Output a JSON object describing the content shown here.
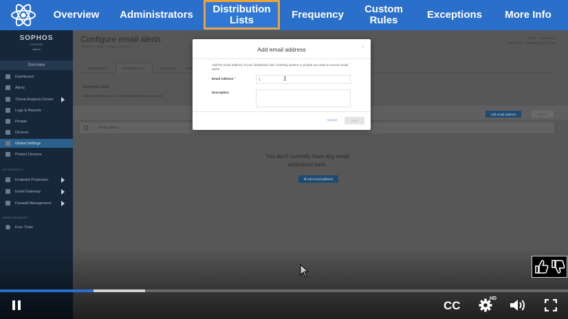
{
  "chapters": {
    "items": [
      {
        "label": "Overview"
      },
      {
        "label": "Administrators"
      },
      {
        "label": "Distribution\nLists",
        "active": true
      },
      {
        "label": "Frequency"
      },
      {
        "label": "Custom\nRules"
      },
      {
        "label": "Exceptions"
      },
      {
        "label": "More Info"
      }
    ],
    "bar_color": "#2a6fc9",
    "active_border_color": "#f0a23a",
    "logo_icon": "atom-icon"
  },
  "sidebar": {
    "brand": "SOPHOS",
    "brand_sub": "CENTRAL",
    "brand_role": "Admin",
    "overview_label": "Overview",
    "items": [
      {
        "label": "Dashboard",
        "icon": "dashboard-icon"
      },
      {
        "label": "Alerts",
        "icon": "alert-icon"
      },
      {
        "label": "Threat Analysis Center",
        "icon": "threat-icon",
        "expandable": true
      },
      {
        "label": "Logs & Reports",
        "icon": "report-icon"
      },
      {
        "label": "People",
        "icon": "people-icon"
      },
      {
        "label": "Devices",
        "icon": "devices-icon"
      },
      {
        "label": "Global Settings",
        "icon": "gear-icon",
        "active": true
      },
      {
        "label": "Protect Devices",
        "icon": "download-icon"
      }
    ],
    "section_products": "MY PRODUCTS",
    "product_items": [
      {
        "label": "Endpoint Protection",
        "icon": "endpoint-icon",
        "expandable": true
      },
      {
        "label": "Email Gateway",
        "icon": "email-icon",
        "expandable": true
      },
      {
        "label": "Firewall Management",
        "icon": "firewall-icon",
        "expandable": true
      }
    ],
    "section_more": "MORE PRODUCTS",
    "more_items": [
      {
        "label": "Free Trials",
        "icon": "plus-circle-icon"
      }
    ]
  },
  "main": {
    "title": "Configure email alerts",
    "breadcrumb": "Settings & Policies  /  Configure email alerts",
    "help_label": "Help ▾",
    "user_name": "Jason Lee ▾",
    "user_org": "Sophos Inc. Standard   Super Admin",
    "tabs": [
      {
        "label": "Administrators"
      },
      {
        "label": "Distribution lists",
        "active": true
      },
      {
        "label": "Frequency"
      },
      {
        "label": "Cust"
      }
    ],
    "section_title": "Distribution lists",
    "section_desc": "Add the distribution lists or email addresses that you want t",
    "add_button": "Add email address",
    "delete_button": "Delete",
    "table_header": "Email address",
    "empty_message": "You don't currently have any email addresses here.",
    "empty_add_button": "✚ Add email address"
  },
  "modal": {
    "title": "Add email address",
    "close": "×",
    "description": "Add the email address of your distribution lists, ticketing system or people you want to receive email alerts.",
    "email_label": "Email Address",
    "required_mark": "*",
    "email_value": "|",
    "description_label": "Description",
    "description_value": "",
    "cancel_label": "Cancel",
    "save_label": "Save"
  },
  "player": {
    "progress": 0.165,
    "buffered": 0.255,
    "cc_label": "CC",
    "hd_label": "HD",
    "progress_color": "#2a6fc9",
    "icons": [
      "pause-icon",
      "settings-icon",
      "volume-icon",
      "fullscreen-icon",
      "thumbs-up-icon",
      "thumbs-down-icon"
    ]
  }
}
